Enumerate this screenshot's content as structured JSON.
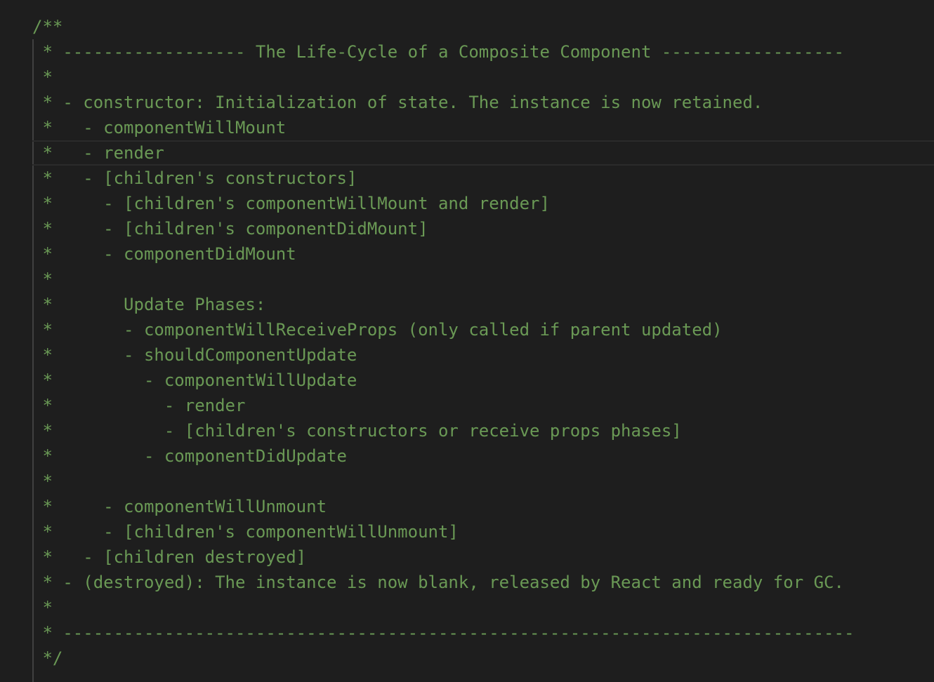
{
  "editor": {
    "comment_color": "#6a9955",
    "background": "#1e1e1e",
    "current_line_index": 5,
    "lines": [
      "/**",
      " * ------------------ The Life-Cycle of a Composite Component ------------------",
      " *",
      " * - constructor: Initialization of state. The instance is now retained.",
      " *   - componentWillMount",
      " *   - render",
      " *   - [children's constructors]",
      " *     - [children's componentWillMount and render]",
      " *     - [children's componentDidMount]",
      " *     - componentDidMount",
      " *",
      " *       Update Phases:",
      " *       - componentWillReceiveProps (only called if parent updated)",
      " *       - shouldComponentUpdate",
      " *         - componentWillUpdate",
      " *           - render",
      " *           - [children's constructors or receive props phases]",
      " *         - componentDidUpdate",
      " *",
      " *     - componentWillUnmount",
      " *     - [children's componentWillUnmount]",
      " *   - [children destroyed]",
      " * - (destroyed): The instance is now blank, released by React and ready for GC.",
      " *",
      " * ------------------------------------------------------------------------------",
      " */"
    ]
  }
}
